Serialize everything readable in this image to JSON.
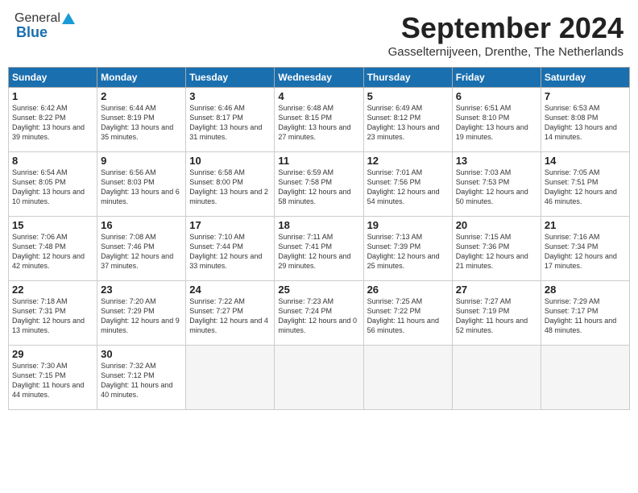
{
  "header": {
    "logo_general": "General",
    "logo_blue": "Blue",
    "month": "September 2024",
    "location": "Gasselternijveen, Drenthe, The Netherlands"
  },
  "days_of_week": [
    "Sunday",
    "Monday",
    "Tuesday",
    "Wednesday",
    "Thursday",
    "Friday",
    "Saturday"
  ],
  "weeks": [
    [
      {
        "day": "1",
        "sunrise": "Sunrise: 6:42 AM",
        "sunset": "Sunset: 8:22 PM",
        "daylight": "Daylight: 13 hours and 39 minutes."
      },
      {
        "day": "2",
        "sunrise": "Sunrise: 6:44 AM",
        "sunset": "Sunset: 8:19 PM",
        "daylight": "Daylight: 13 hours and 35 minutes."
      },
      {
        "day": "3",
        "sunrise": "Sunrise: 6:46 AM",
        "sunset": "Sunset: 8:17 PM",
        "daylight": "Daylight: 13 hours and 31 minutes."
      },
      {
        "day": "4",
        "sunrise": "Sunrise: 6:48 AM",
        "sunset": "Sunset: 8:15 PM",
        "daylight": "Daylight: 13 hours and 27 minutes."
      },
      {
        "day": "5",
        "sunrise": "Sunrise: 6:49 AM",
        "sunset": "Sunset: 8:12 PM",
        "daylight": "Daylight: 13 hours and 23 minutes."
      },
      {
        "day": "6",
        "sunrise": "Sunrise: 6:51 AM",
        "sunset": "Sunset: 8:10 PM",
        "daylight": "Daylight: 13 hours and 19 minutes."
      },
      {
        "day": "7",
        "sunrise": "Sunrise: 6:53 AM",
        "sunset": "Sunset: 8:08 PM",
        "daylight": "Daylight: 13 hours and 14 minutes."
      }
    ],
    [
      {
        "day": "8",
        "sunrise": "Sunrise: 6:54 AM",
        "sunset": "Sunset: 8:05 PM",
        "daylight": "Daylight: 13 hours and 10 minutes."
      },
      {
        "day": "9",
        "sunrise": "Sunrise: 6:56 AM",
        "sunset": "Sunset: 8:03 PM",
        "daylight": "Daylight: 13 hours and 6 minutes."
      },
      {
        "day": "10",
        "sunrise": "Sunrise: 6:58 AM",
        "sunset": "Sunset: 8:00 PM",
        "daylight": "Daylight: 13 hours and 2 minutes."
      },
      {
        "day": "11",
        "sunrise": "Sunrise: 6:59 AM",
        "sunset": "Sunset: 7:58 PM",
        "daylight": "Daylight: 12 hours and 58 minutes."
      },
      {
        "day": "12",
        "sunrise": "Sunrise: 7:01 AM",
        "sunset": "Sunset: 7:56 PM",
        "daylight": "Daylight: 12 hours and 54 minutes."
      },
      {
        "day": "13",
        "sunrise": "Sunrise: 7:03 AM",
        "sunset": "Sunset: 7:53 PM",
        "daylight": "Daylight: 12 hours and 50 minutes."
      },
      {
        "day": "14",
        "sunrise": "Sunrise: 7:05 AM",
        "sunset": "Sunset: 7:51 PM",
        "daylight": "Daylight: 12 hours and 46 minutes."
      }
    ],
    [
      {
        "day": "15",
        "sunrise": "Sunrise: 7:06 AM",
        "sunset": "Sunset: 7:48 PM",
        "daylight": "Daylight: 12 hours and 42 minutes."
      },
      {
        "day": "16",
        "sunrise": "Sunrise: 7:08 AM",
        "sunset": "Sunset: 7:46 PM",
        "daylight": "Daylight: 12 hours and 37 minutes."
      },
      {
        "day": "17",
        "sunrise": "Sunrise: 7:10 AM",
        "sunset": "Sunset: 7:44 PM",
        "daylight": "Daylight: 12 hours and 33 minutes."
      },
      {
        "day": "18",
        "sunrise": "Sunrise: 7:11 AM",
        "sunset": "Sunset: 7:41 PM",
        "daylight": "Daylight: 12 hours and 29 minutes."
      },
      {
        "day": "19",
        "sunrise": "Sunrise: 7:13 AM",
        "sunset": "Sunset: 7:39 PM",
        "daylight": "Daylight: 12 hours and 25 minutes."
      },
      {
        "day": "20",
        "sunrise": "Sunrise: 7:15 AM",
        "sunset": "Sunset: 7:36 PM",
        "daylight": "Daylight: 12 hours and 21 minutes."
      },
      {
        "day": "21",
        "sunrise": "Sunrise: 7:16 AM",
        "sunset": "Sunset: 7:34 PM",
        "daylight": "Daylight: 12 hours and 17 minutes."
      }
    ],
    [
      {
        "day": "22",
        "sunrise": "Sunrise: 7:18 AM",
        "sunset": "Sunset: 7:31 PM",
        "daylight": "Daylight: 12 hours and 13 minutes."
      },
      {
        "day": "23",
        "sunrise": "Sunrise: 7:20 AM",
        "sunset": "Sunset: 7:29 PM",
        "daylight": "Daylight: 12 hours and 9 minutes."
      },
      {
        "day": "24",
        "sunrise": "Sunrise: 7:22 AM",
        "sunset": "Sunset: 7:27 PM",
        "daylight": "Daylight: 12 hours and 4 minutes."
      },
      {
        "day": "25",
        "sunrise": "Sunrise: 7:23 AM",
        "sunset": "Sunset: 7:24 PM",
        "daylight": "Daylight: 12 hours and 0 minutes."
      },
      {
        "day": "26",
        "sunrise": "Sunrise: 7:25 AM",
        "sunset": "Sunset: 7:22 PM",
        "daylight": "Daylight: 11 hours and 56 minutes."
      },
      {
        "day": "27",
        "sunrise": "Sunrise: 7:27 AM",
        "sunset": "Sunset: 7:19 PM",
        "daylight": "Daylight: 11 hours and 52 minutes."
      },
      {
        "day": "28",
        "sunrise": "Sunrise: 7:29 AM",
        "sunset": "Sunset: 7:17 PM",
        "daylight": "Daylight: 11 hours and 48 minutes."
      }
    ],
    [
      {
        "day": "29",
        "sunrise": "Sunrise: 7:30 AM",
        "sunset": "Sunset: 7:15 PM",
        "daylight": "Daylight: 11 hours and 44 minutes."
      },
      {
        "day": "30",
        "sunrise": "Sunrise: 7:32 AM",
        "sunset": "Sunset: 7:12 PM",
        "daylight": "Daylight: 11 hours and 40 minutes."
      },
      null,
      null,
      null,
      null,
      null
    ]
  ]
}
